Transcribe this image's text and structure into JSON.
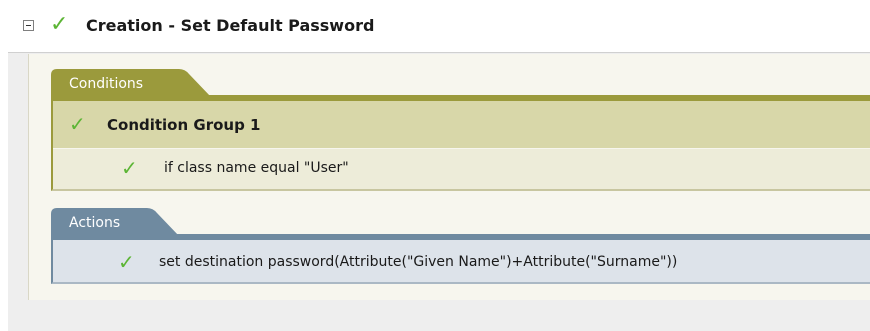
{
  "rule": {
    "title": "Creation - Set Default Password",
    "check_icon": "checkmark-icon",
    "collapse_icon": "collapse-minus-icon"
  },
  "conditions": {
    "tab_label": "Conditions",
    "group": {
      "title": "Condition Group 1",
      "items": [
        {
          "text": "if class name equal \"User\""
        }
      ]
    }
  },
  "actions": {
    "tab_label": "Actions",
    "items": [
      {
        "text": "set destination password(Attribute(\"Given Name\")+Attribute(\"Surname\"))"
      }
    ]
  },
  "colors": {
    "check": "#5cb535",
    "conditions_accent": "#9b9a3c",
    "conditions_group_bg": "#d8d7a9",
    "conditions_item_bg": "#edecd9",
    "actions_accent": "#6f8aa0",
    "actions_item_bg": "#dde3ea"
  }
}
